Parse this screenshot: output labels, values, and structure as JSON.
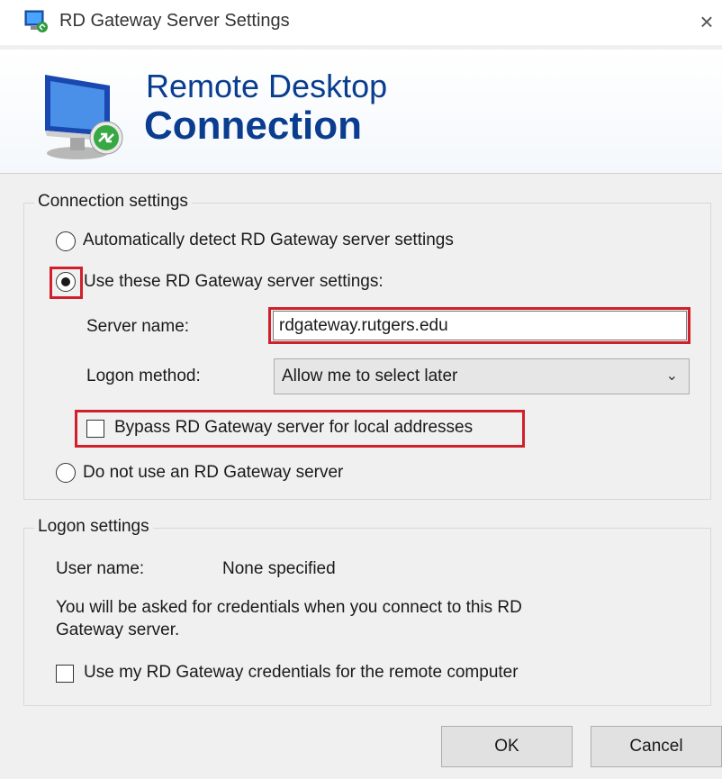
{
  "window": {
    "title": "RD Gateway Server Settings",
    "close_glyph": "×"
  },
  "banner": {
    "line1": "Remote Desktop",
    "line2": "Connection"
  },
  "connection_settings": {
    "legend": "Connection settings",
    "auto_detect_label": "Automatically detect RD Gateway server settings",
    "use_settings_label": "Use these RD Gateway server settings:",
    "server_name_label": "Server name:",
    "server_name_value": "rdgateway.rutgers.edu",
    "logon_method_label": "Logon method:",
    "logon_method_value": "Allow me to select later",
    "bypass_label": "Bypass RD Gateway server for local addresses",
    "do_not_use_label": "Do not use an RD Gateway server",
    "selected_option": "use_settings"
  },
  "logon_settings": {
    "legend": "Logon settings",
    "user_name_label": "User name:",
    "user_name_value": "None specified",
    "info_line1": "You will be asked for credentials when you connect to this RD",
    "info_line2": "Gateway server.",
    "use_credentials_label": "Use my RD Gateway credentials for the remote computer"
  },
  "buttons": {
    "ok": "OK",
    "cancel": "Cancel"
  },
  "colors": {
    "highlight": "#d0202c",
    "banner_text": "#0a3d8f"
  },
  "icons": {
    "app": "remote-desktop-icon",
    "banner": "monitor-connection-icon",
    "dropdown": "chevron-down-icon",
    "close": "close-icon"
  }
}
